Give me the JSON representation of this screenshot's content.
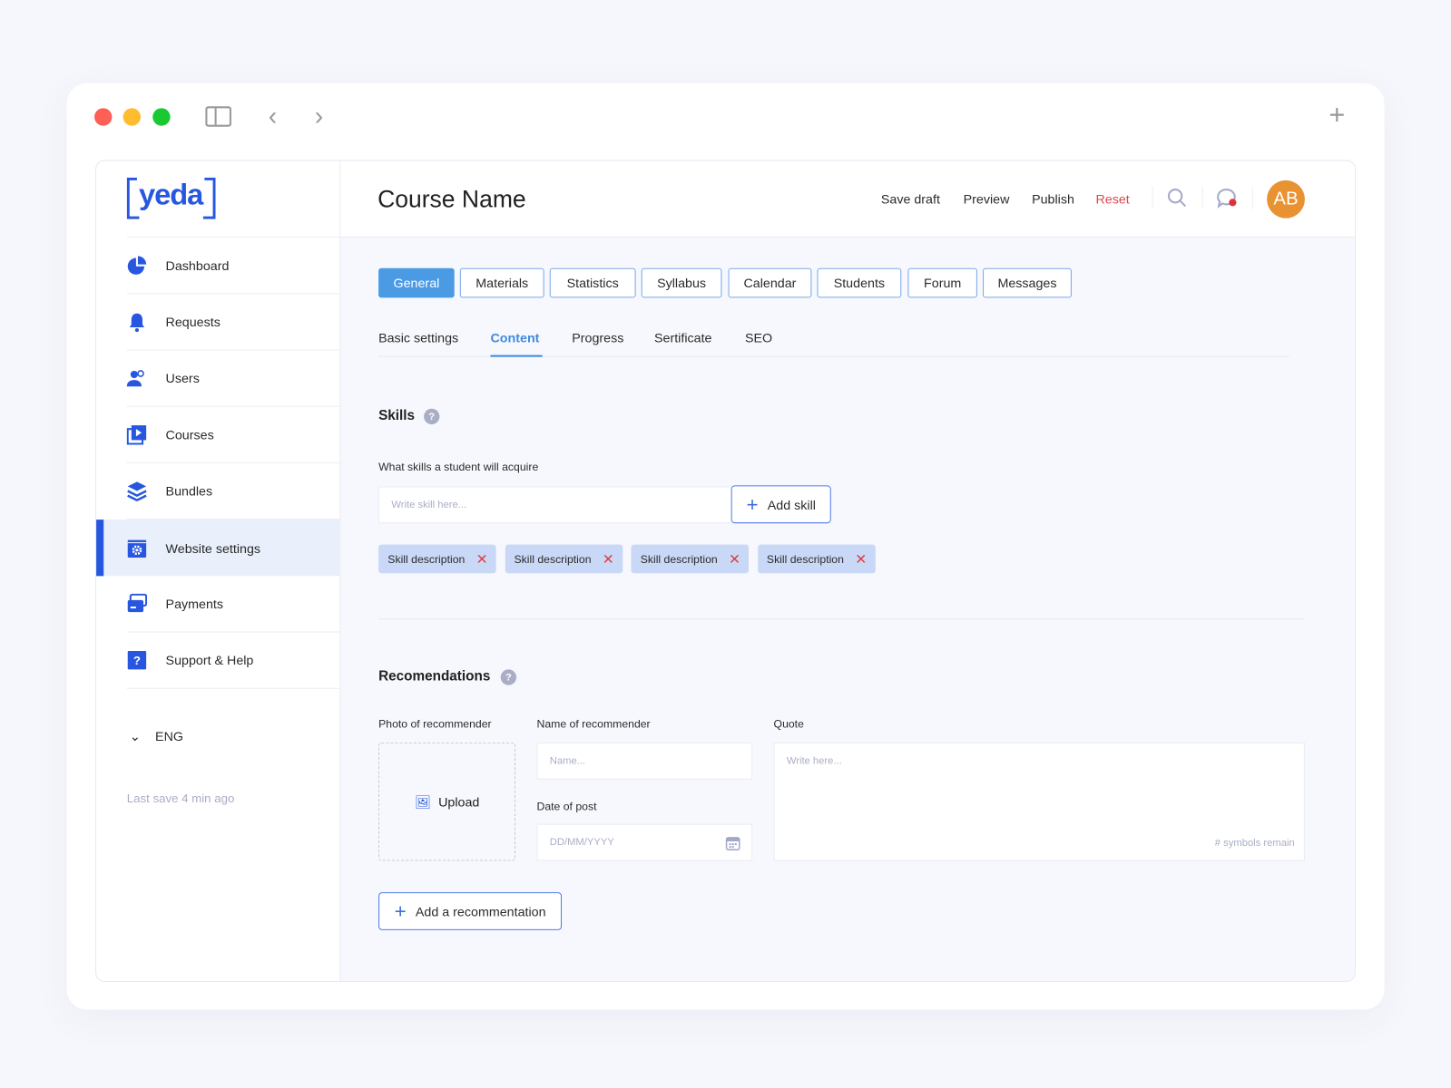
{
  "window": {
    "colors": {
      "close": "#fe5f57",
      "minimize": "#febc2e",
      "maximize": "#19c932"
    }
  },
  "brand": {
    "logo": "yeda",
    "color": "#2757e0"
  },
  "sidebar": {
    "items": [
      {
        "label": "Dashboard",
        "icon": "pie-chart-icon"
      },
      {
        "label": "Requests",
        "icon": "bell-icon"
      },
      {
        "label": "Users",
        "icon": "users-icon"
      },
      {
        "label": "Courses",
        "icon": "play-icon"
      },
      {
        "label": "Bundles",
        "icon": "layers-icon"
      },
      {
        "label": "Website settings",
        "icon": "settings-window-icon",
        "active": true
      },
      {
        "label": "Payments",
        "icon": "credit-card-icon"
      },
      {
        "label": "Support & Help",
        "icon": "question-icon"
      }
    ],
    "language": "ENG",
    "last_save": "Last save 4 min ago"
  },
  "header": {
    "title": "Course Name",
    "save_draft": "Save draft",
    "preview": "Preview",
    "publish": "Publish",
    "reset": "Reset",
    "avatar": "AB",
    "reset_color": "#e0474c",
    "avatar_color": "#e89232"
  },
  "tabs": [
    "General",
    "Materials",
    "Statistics",
    "Syllabus",
    "Calendar",
    "Students",
    "Forum",
    "Messages"
  ],
  "subtabs": [
    "Basic settings",
    "Content",
    "Progress",
    "Sertificate",
    "SEO"
  ],
  "skills": {
    "title": "Skills",
    "help": "?",
    "label": "What skills a student will acquire",
    "placeholder": "Write skill here...",
    "add": "Add skill",
    "chips": [
      "Skill description",
      "Skill description",
      "Skill description",
      "Skill description"
    ]
  },
  "recommendations": {
    "title": "Recomendations",
    "help": "?",
    "photo_label": "Photo of recommender",
    "upload": "Upload",
    "name_label": "Name of recommender",
    "name_placeholder": "Name...",
    "date_label": "Date of post",
    "date_placeholder": "DD/MM/YYYY",
    "quote_label": "Quote",
    "quote_placeholder": "Write here...",
    "symbols": "# symbols remain",
    "add": "Add a recommentation"
  }
}
